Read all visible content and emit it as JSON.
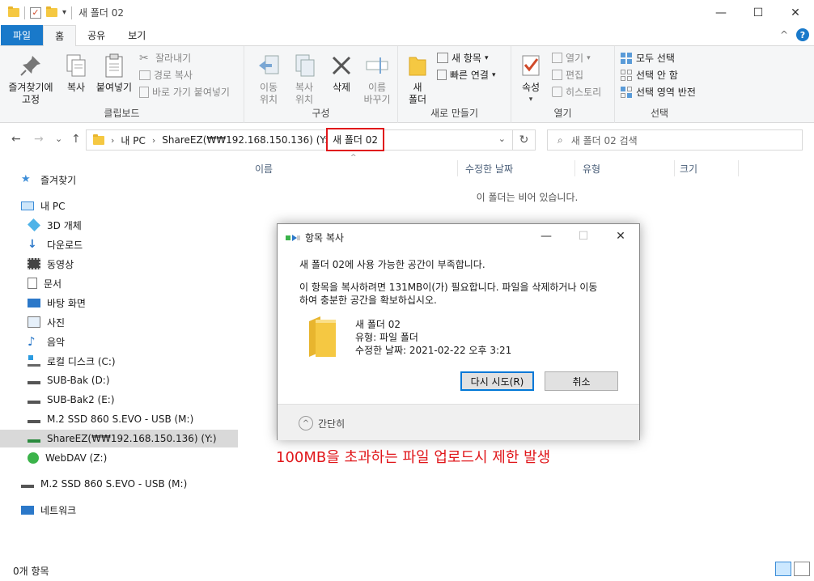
{
  "window": {
    "title": "새 폴더 02",
    "minimize_glyph": "—",
    "maximize_glyph": "☐",
    "close_glyph": "✕",
    "qat_dropdown_glyph": "▾"
  },
  "ribbon_tabs": [
    "파일",
    "홈",
    "공유",
    "보기"
  ],
  "ribbon_right": {
    "collapse_glyph": "^",
    "help_glyph": "?"
  },
  "ribbon": {
    "clipboard": {
      "pin": "즐겨찾기에\n고정",
      "copy": "복사",
      "paste": "붙여넣기",
      "cut": "잘라내기",
      "copy_path": "경로 복사",
      "paste_shortcut": "바로 가기 붙여넣기",
      "label": "클립보드"
    },
    "organize": {
      "move_to": "이동\n위치",
      "copy_to": "복사\n위치",
      "delete": "삭제",
      "rename": "이름\n바꾸기",
      "label": "구성"
    },
    "new": {
      "new_folder": "새\n폴더",
      "new_item": "새 항목",
      "easy_access": "빠른 연결",
      "label": "새로 만들기"
    },
    "open": {
      "properties": "속성",
      "open": "열기",
      "edit": "편집",
      "history": "히스토리",
      "label": "열기"
    },
    "select": {
      "select_all": "모두 선택",
      "select_none": "선택 안 함",
      "invert": "선택 영역 반전",
      "label": "선택"
    }
  },
  "address": {
    "back_glyph": "←",
    "forward_glyph": "→",
    "recent_glyph": "⌄",
    "up_glyph": "↑",
    "sep_glyph": "›",
    "dropdown_glyph": "⌄",
    "refresh_glyph": "↻",
    "crumbs": [
      "내 PC",
      "ShareEZ(₩₩192.168.150.136) (Y:)",
      "새 폴더 02"
    ],
    "search_placeholder": "새 폴더 02 검색",
    "search_glyph": "⌕"
  },
  "sidebar": {
    "items": [
      {
        "label": "즐겨찾기",
        "icon": "star-icon"
      },
      {
        "label": "내 PC",
        "icon": "pc-icon"
      },
      {
        "label": "3D 개체",
        "icon": "cube-icon"
      },
      {
        "label": "다운로드",
        "icon": "download-icon"
      },
      {
        "label": "동영상",
        "icon": "video-icon"
      },
      {
        "label": "문서",
        "icon": "document-icon"
      },
      {
        "label": "바탕 화면",
        "icon": "desktop-icon"
      },
      {
        "label": "사진",
        "icon": "pictures-icon"
      },
      {
        "label": "음악",
        "icon": "music-icon"
      },
      {
        "label": "로컬 디스크 (C:)",
        "icon": "windows-drive-icon"
      },
      {
        "label": "SUB-Bak (D:)",
        "icon": "drive-icon"
      },
      {
        "label": "SUB-Bak2 (E:)",
        "icon": "drive-icon"
      },
      {
        "label": "M.2 SSD 860 S.EVO - USB (M:)",
        "icon": "usb-drive-icon"
      },
      {
        "label": "ShareEZ(₩₩192.168.150.136) (Y:)",
        "icon": "network-drive-icon"
      },
      {
        "label": "WebDAV (Z:)",
        "icon": "webdav-drive-icon"
      },
      {
        "label": "M.2 SSD 860 S.EVO - USB (M:)",
        "icon": "usb-drive-icon"
      },
      {
        "label": "네트워크",
        "icon": "network-icon"
      }
    ]
  },
  "columns": [
    "이름",
    "수정한 날짜",
    "유형",
    "크기"
  ],
  "sort_glyph": "^",
  "empty_message": "이 폴더는 비어 있습니다.",
  "status": {
    "item_count": "0개 항목"
  },
  "dialog": {
    "title": "항목 복사",
    "line1": "새 폴더 02에 사용 가능한 공간이 부족합니다.",
    "line2": "이 항목을 복사하려면 131MB이(가) 필요합니다. 파일을 삭제하거나 이동",
    "line3": "하여 충분한 공간을 확보하십시오.",
    "item_name": "새 폴더 02",
    "item_type": "유형: 파일 폴더",
    "item_modified": "수정한 날짜: 2021-02-22 오후 3:21",
    "retry": "다시 시도(R)",
    "cancel": "취소",
    "collapse": "간단히",
    "collapse_glyph": "^"
  },
  "annotation": "100MB을 초과하는 파일 업로드시 제한 발생",
  "colors": {
    "accent": "#1979ca",
    "highlight_red": "#e0161a",
    "folder": "#f5c842",
    "selection": "#cce8ff"
  }
}
